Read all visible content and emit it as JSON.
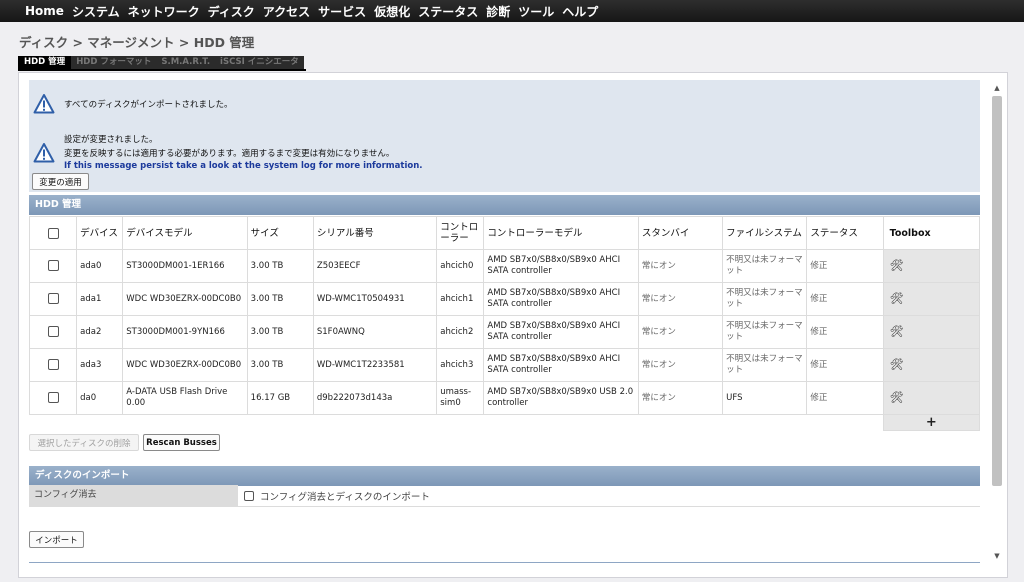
{
  "nav": [
    "Home",
    "システム",
    "ネットワーク",
    "ディスク",
    "アクセス",
    "サービス",
    "仮想化",
    "ステータス",
    "診断",
    "ツール",
    "ヘルプ"
  ],
  "breadcrumb": "ディスク > マネージメント > HDD 管理",
  "tabs": [
    {
      "label": "HDD 管理",
      "active": true
    },
    {
      "label": "HDD フォーマット",
      "active": false
    },
    {
      "label": "S.M.A.R.T.",
      "active": false
    },
    {
      "label": "iSCSI イニシエータ",
      "active": false
    }
  ],
  "notice": {
    "msg1": "すべてのディスクがインポートされました。",
    "msg2_line1": "設定が変更されました。",
    "msg2_line2": "変更を反映するには適用する必要があります。適用するまで変更は有効になりません。",
    "msg2_link": "If this message persist take a look at the system log for more information.",
    "apply_button": "変更の適用",
    "icon": "warning-triangle-icon"
  },
  "hdd_section": {
    "title": "HDD 管理",
    "columns": [
      "デバイス",
      "デバイスモデル",
      "サイズ",
      "シリアル番号",
      "コントローラー",
      "コントローラーモデル",
      "スタンバイ",
      "ファイルシステム",
      "ステータス",
      "Toolbox"
    ],
    "rows": [
      {
        "device": "ada0",
        "model": "ST3000DM001-1ER166",
        "size": "3.00 TB",
        "serial": "Z503EECF",
        "controller": "ahcich0",
        "controller_model": "AMD SB7x0/SB8x0/SB9x0 AHCI SATA controller",
        "standby": "常にオン",
        "filesystem": "不明又は未フォーマット",
        "status": "修正"
      },
      {
        "device": "ada1",
        "model": "WDC WD30EZRX-00DC0B0",
        "size": "3.00 TB",
        "serial": "WD-WMC1T0504931",
        "controller": "ahcich1",
        "controller_model": "AMD SB7x0/SB8x0/SB9x0 AHCI SATA controller",
        "standby": "常にオン",
        "filesystem": "不明又は未フォーマット",
        "status": "修正"
      },
      {
        "device": "ada2",
        "model": "ST3000DM001-9YN166",
        "size": "3.00 TB",
        "serial": "S1F0AWNQ",
        "controller": "ahcich2",
        "controller_model": "AMD SB7x0/SB8x0/SB9x0 AHCI SATA controller",
        "standby": "常にオン",
        "filesystem": "不明又は未フォーマット",
        "status": "修正"
      },
      {
        "device": "ada3",
        "model": "WDC WD30EZRX-00DC0B0",
        "size": "3.00 TB",
        "serial": "WD-WMC1T2233581",
        "controller": "ahcich3",
        "controller_model": "AMD SB7x0/SB8x0/SB9x0 AHCI SATA controller",
        "standby": "常にオン",
        "filesystem": "不明又は未フォーマット",
        "status": "修正"
      },
      {
        "device": "da0",
        "model": "A-DATA USB Flash Drive 0.00",
        "size": "16.17 GB",
        "serial": "d9b222073d143a",
        "controller": "umass-sim0",
        "controller_model": "AMD SB7x0/SB8x0/SB9x0 USB 2.0 controller",
        "standby": "常にオン",
        "filesystem": "UFS",
        "status": "修正"
      }
    ],
    "add_symbol": "+",
    "delete_button": "選択したディスクの削除",
    "rescan_button": "Rescan Busses"
  },
  "import_section": {
    "title": "ディスクのインポート",
    "field_label": "コンフィグ消去",
    "checkbox_label": "コンフィグ消去とディスクのインポート",
    "import_button": "インポート"
  }
}
